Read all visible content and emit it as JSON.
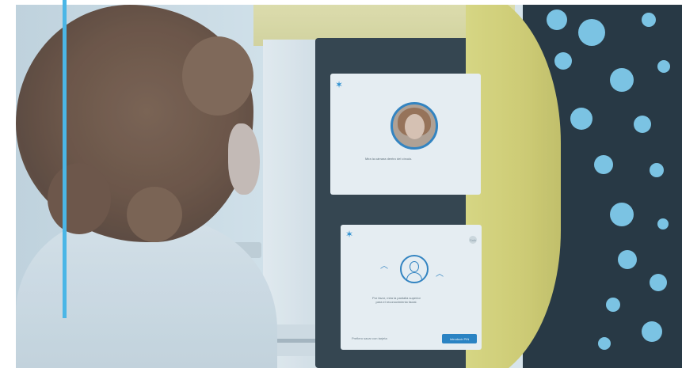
{
  "scene": {
    "top_screen_caption": "Mira la cámara dentro del círculo.",
    "bottom_screen_caption_line1": "Por favor, mira la pantalla superior",
    "bottom_screen_caption_line2": "para el reconocimiento facial.",
    "link_text": "Prefiero sacar con tarjeta",
    "pin_button_label": "Introducir PIN",
    "exit_label": "Salir"
  },
  "colors": {
    "accent_bar": "#4bb6e6",
    "kiosk_yellow": "#e3dc7a",
    "dots": "#7cc6e6",
    "brand_blue": "#1f7ec2"
  },
  "icons": {
    "brand": "star-logo-icon",
    "avatar": "face-avatar-icon",
    "arrows": "chevron-up-icon"
  }
}
